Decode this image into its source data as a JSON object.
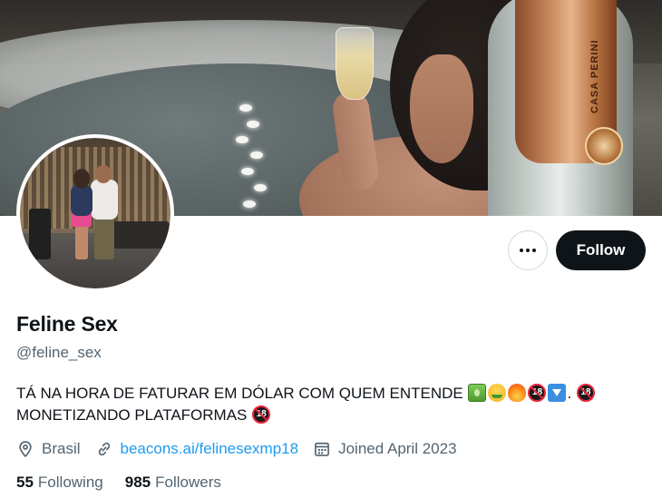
{
  "profile": {
    "display_name": "Feline Sex",
    "handle": "@feline_sex",
    "bio_line1": "TÁ NA HORA DE FATURAR EM DÓLAR COM QUEM ENTENDE",
    "bio_sep": ". ",
    "bio_line2": "MONETIZANDO PLATAFORMAS",
    "location": "Brasil",
    "website": "beacons.ai/felinesexmp18",
    "joined": "Joined April 2023",
    "following_count": "55",
    "following_label": "Following",
    "followers_count": "985",
    "followers_label": "Followers"
  },
  "banner": {
    "bottle_label": "CASA PERINI"
  },
  "actions": {
    "follow_label": "Follow"
  },
  "icons": {
    "more": "more-horizontal-icon",
    "location": "location-pin-icon",
    "link": "link-icon",
    "calendar": "calendar-icon",
    "bio_emojis_1": [
      "money-bill-emoji",
      "money-mouth-face-emoji",
      "fire-emoji",
      "no-one-under-18-emoji",
      "down-arrow-emoji"
    ],
    "bio_emojis_2": [
      "no-one-under-18-emoji"
    ],
    "bio_emojis_3": [
      "no-one-under-18-emoji"
    ]
  },
  "colors": {
    "text_primary": "#0f1419",
    "text_secondary": "#536471",
    "link": "#1d9bf0",
    "follow_button_bg": "#0f1419"
  }
}
